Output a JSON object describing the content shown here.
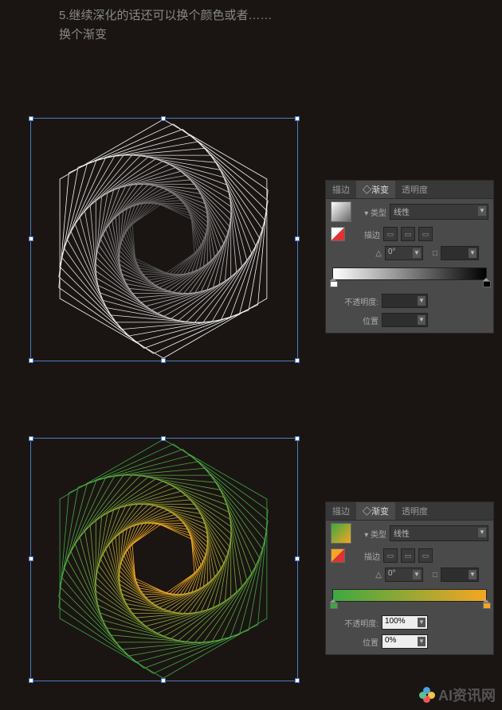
{
  "instruction": {
    "line1": "5.继续深化的话还可以换个颜色或者……",
    "line2": "换个渐变"
  },
  "panel_top": {
    "tabs": [
      "描边",
      "◇渐变",
      "透明度"
    ],
    "active_tab": 1,
    "type_label": "▾ 类型",
    "type_value": "线性",
    "stroke_label": "描边",
    "angle_label": "△",
    "angle_value": "0°",
    "ratio_label": "□",
    "opacity_label": "不透明度:",
    "opacity_value": "",
    "position_label": "位置",
    "position_value": "",
    "gradient": {
      "stops": [
        "#ffffff",
        "#000000"
      ]
    }
  },
  "panel_bottom": {
    "tabs": [
      "描边",
      "◇渐变",
      "透明度"
    ],
    "active_tab": 1,
    "type_label": "▾ 类型",
    "type_value": "线性",
    "stroke_label": "描边",
    "angle_label": "△",
    "angle_value": "0°",
    "ratio_label": "□",
    "opacity_label": "不透明度:",
    "opacity_value": "100%",
    "position_label": "位置",
    "position_value": "0%",
    "gradient": {
      "stops": [
        "#3da843",
        "#f5a623"
      ]
    }
  },
  "watermark": {
    "text": "AI资讯网"
  },
  "chart_data": {
    "type": "diagram",
    "description": "Two hexagonal spiral string-art figures created by iteratively rotating and scaling a hexagon",
    "figures": [
      {
        "shape": "hexagon-spiral",
        "iterations": 36,
        "rotation_step_deg": 5,
        "scale_step": 0.965,
        "stroke": "gradient",
        "gradient": [
          "#ffffff",
          "#555555"
        ],
        "selected": true
      },
      {
        "shape": "hexagon-spiral",
        "iterations": 36,
        "rotation_step_deg": 5,
        "scale_step": 0.965,
        "stroke": "gradient",
        "gradient": [
          "#3da843",
          "#f5a623"
        ],
        "selected": true
      }
    ]
  }
}
